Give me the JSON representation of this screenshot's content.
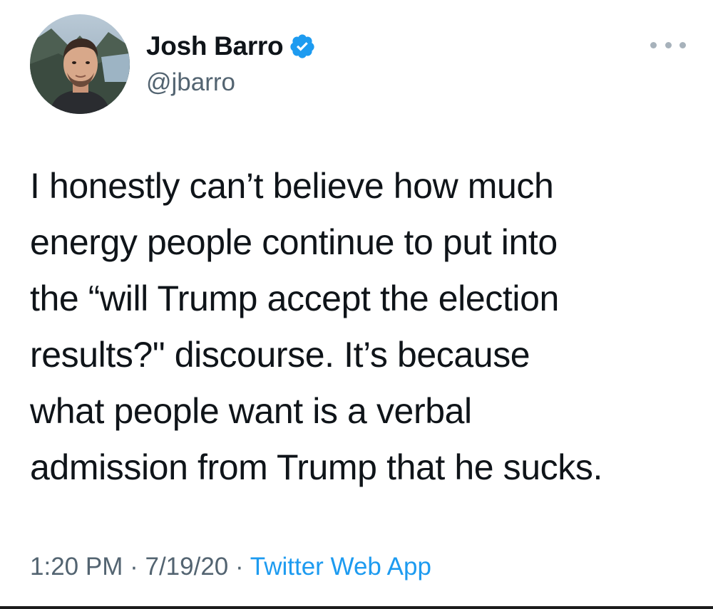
{
  "user": {
    "display_name": "Josh Barro",
    "handle": "@jbarro",
    "verified_icon": "verified-badge-icon",
    "verified_color": "#1d9bf0"
  },
  "menu": {
    "icon": "more-horizontal-icon"
  },
  "tweet": {
    "lines": [
      "I honestly can’t believe how much",
      "energy people continue to put into",
      "the “will Trump accept the election",
      "results?\" discourse. It’s because",
      "what people want is a verbal",
      "admission from Trump that he sucks."
    ]
  },
  "meta": {
    "time": "1:20 PM",
    "separator": "·",
    "date": "7/19/20",
    "source": "Twitter Web App",
    "source_color": "#1d9bf0"
  }
}
